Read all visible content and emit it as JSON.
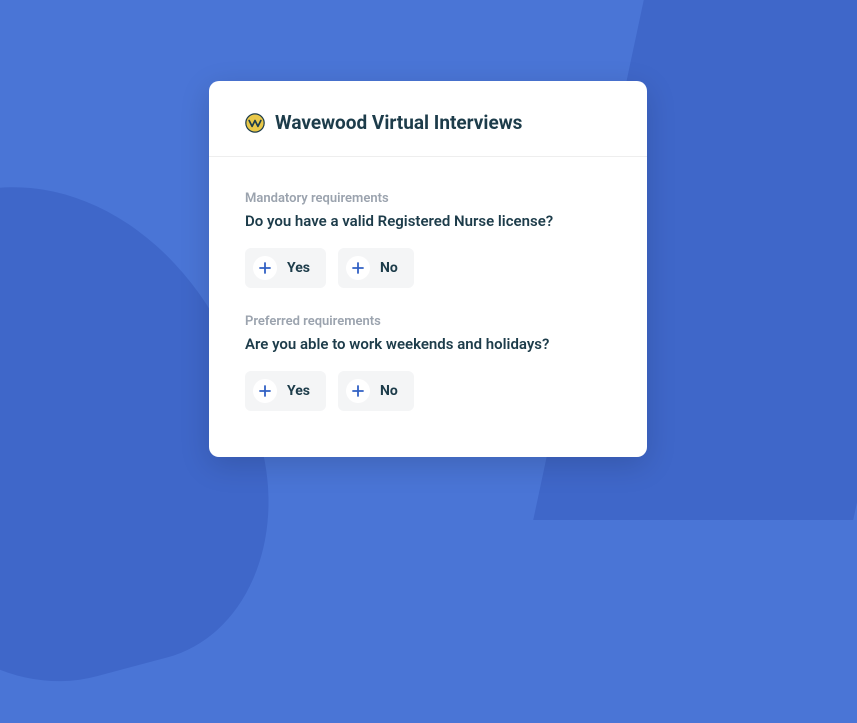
{
  "header": {
    "title": "Wavewood Virtual Interviews"
  },
  "sections": [
    {
      "label": "Mandatory requirements",
      "question": "Do you have a valid Registered Nurse license?",
      "options": {
        "yes": "Yes",
        "no": "No"
      }
    },
    {
      "label": "Preferred requirements",
      "question": "Are you able to work weekends and holidays?",
      "options": {
        "yes": "Yes",
        "no": "No"
      }
    }
  ],
  "colors": {
    "background": "#4a75d6",
    "backgroundShape": "#3f67c9",
    "card": "#ffffff",
    "textDark": "#1d3c4a",
    "textMuted": "#9ba3ae",
    "buttonBg": "#f4f5f6",
    "plusIcon": "#3160c4",
    "logoFill": "#e9c849"
  }
}
